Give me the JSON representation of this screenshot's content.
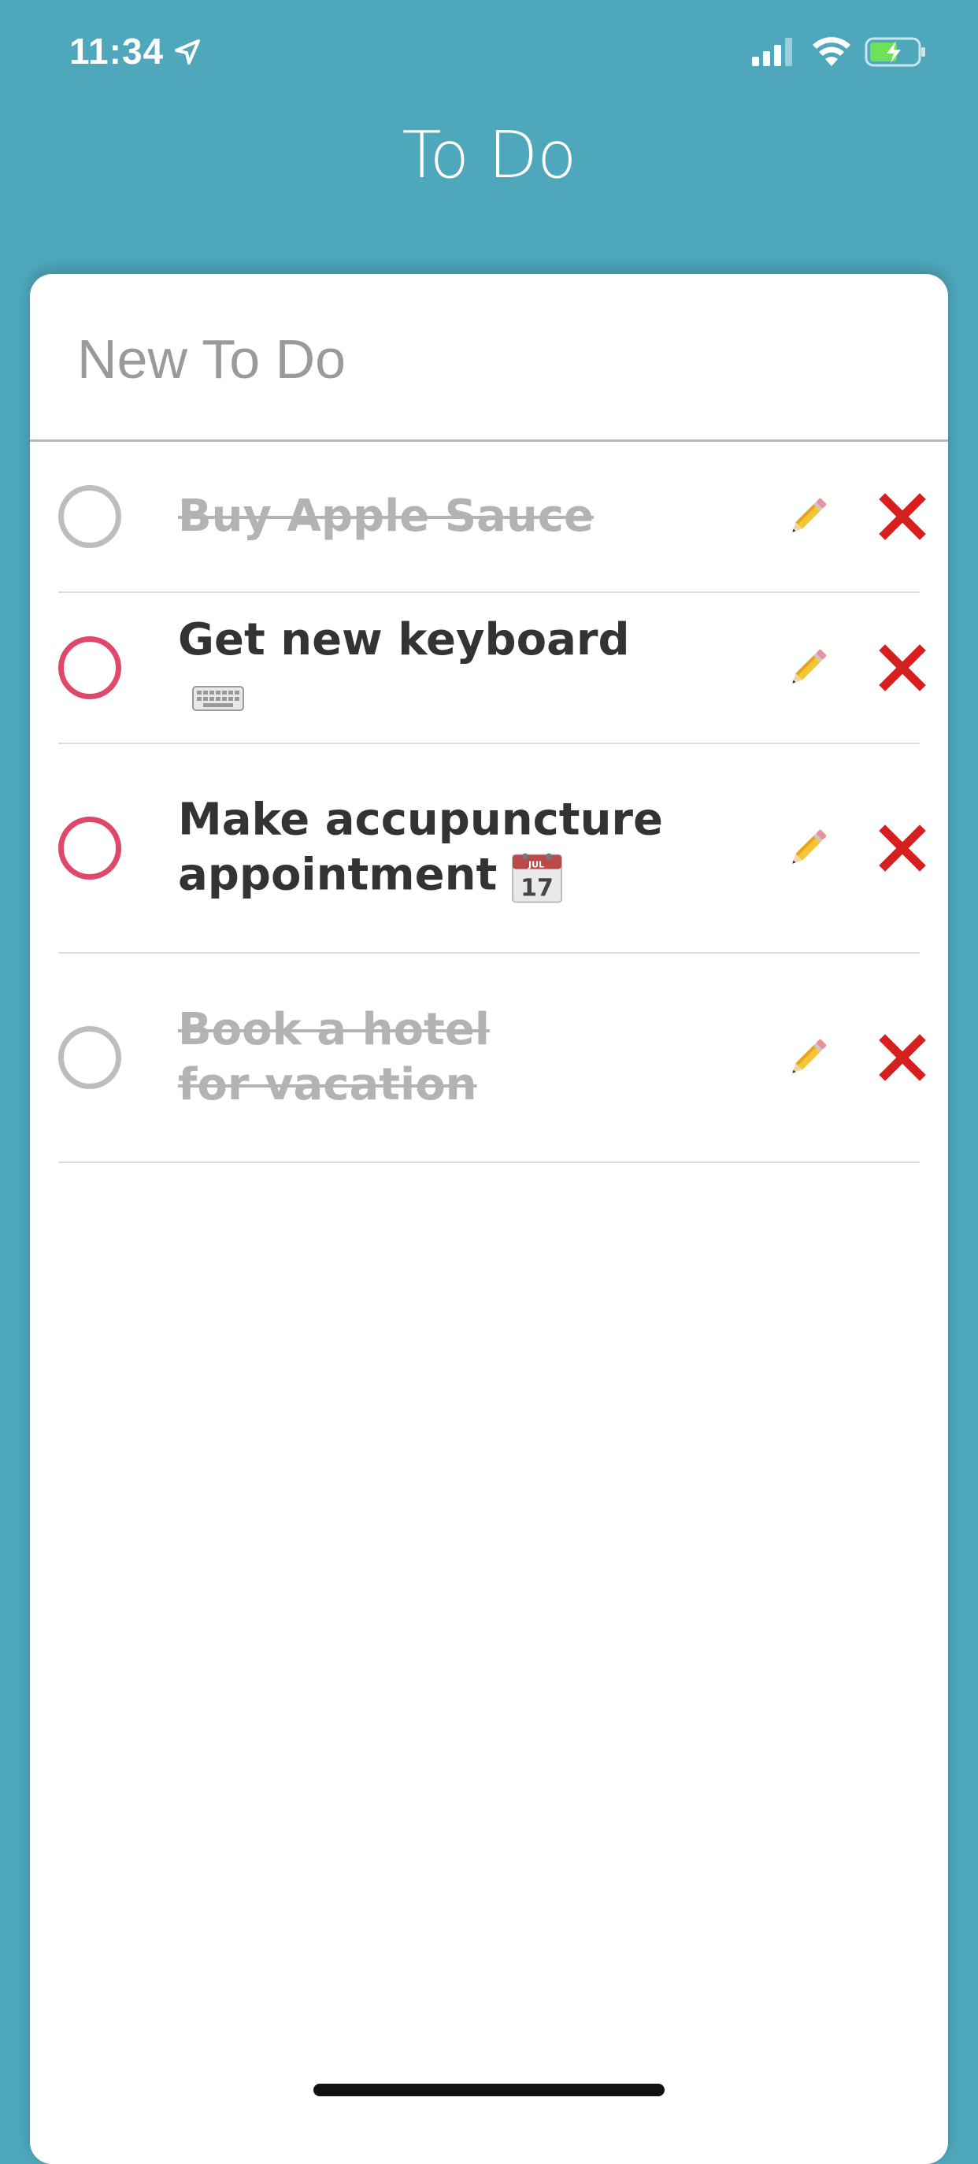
{
  "status_bar": {
    "time": "11:34",
    "icons": [
      "location-arrow-icon",
      "cellular-signal-icon",
      "wifi-icon",
      "battery-charging-icon"
    ]
  },
  "header": {
    "title": "To Do"
  },
  "new_todo": {
    "placeholder": "New To Do",
    "value": ""
  },
  "todos": [
    {
      "text": "Buy Apple Sauce",
      "completed": true,
      "emoji_icon": null
    },
    {
      "text": "Get new keyboard",
      "completed": false,
      "emoji_icon": "keyboard-icon"
    },
    {
      "text": "Make accupuncture appointment",
      "completed": false,
      "emoji_icon": "calendar-icon",
      "calendar_month": "JUL",
      "calendar_day": "17"
    },
    {
      "text": "Book a hotel for vacation",
      "completed": true,
      "emoji_icon": null
    }
  ],
  "row_actions": {
    "edit_icon": "pencil-icon",
    "delete_icon": "close-x-icon"
  },
  "colors": {
    "background": "#4ea7bb",
    "card": "#ffffff",
    "pending_circle": "#e0486a",
    "done_circle": "#bdbdbd",
    "delete_x": "#d6201f",
    "text": "#333333",
    "done_text": "#b3b3b3"
  }
}
